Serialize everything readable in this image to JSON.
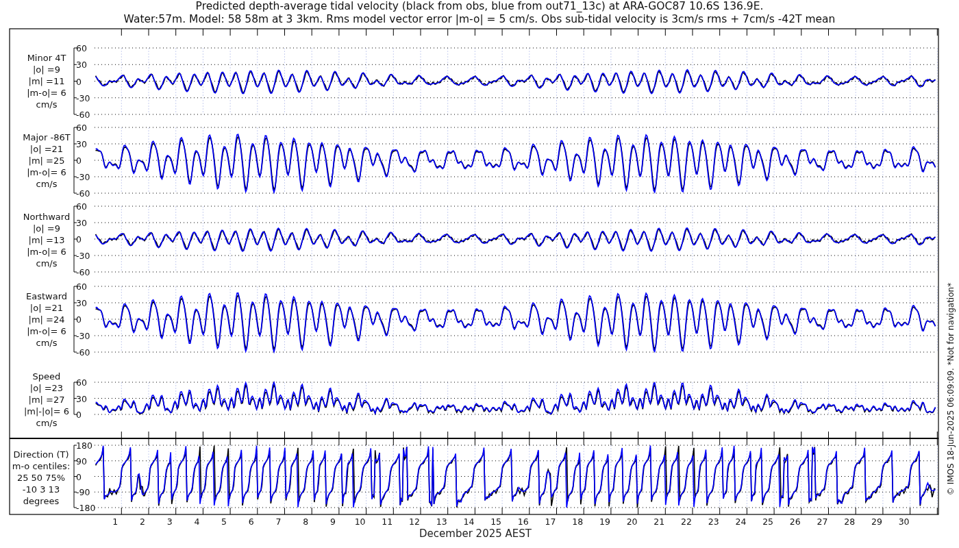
{
  "title": [
    "Predicted depth-average tidal velocity (black from obs, blue from out71_13c) at ARA-GOC87 10.6S 136.9E.",
    "Water:57m. Model: 58 58m at 3 3km. Rms model vector error |m-o| = 5 cm/s. Obs sub-tidal velocity is 3cm/s rms + 7cm/s -42T mean"
  ],
  "panels": [
    {
      "kind": "minor",
      "label_lines": [
        "Minor 4T",
        "|o| =9",
        "|m| =11",
        "|m-o|= 6",
        "cm/s"
      ],
      "yticks": [
        "60",
        "30",
        "0",
        "-30",
        "-60"
      ]
    },
    {
      "kind": "major",
      "label_lines": [
        "Major -86T",
        "|o| =21",
        "|m| =25",
        "|m-o|= 6",
        "cm/s"
      ],
      "yticks": [
        "60",
        "30",
        "0",
        "-30",
        "-60"
      ]
    },
    {
      "kind": "north",
      "label_lines": [
        "Northward",
        "|o| =9",
        "|m| =13",
        "|m-o|= 6",
        "cm/s"
      ],
      "yticks": [
        "60",
        "30",
        "0",
        "-30",
        "-60"
      ]
    },
    {
      "kind": "east",
      "label_lines": [
        "Eastward",
        "|o| =21",
        "|m| =24",
        "|m-o|= 6",
        "cm/s"
      ],
      "yticks": [
        "60",
        "30",
        "0",
        "-30",
        "-60"
      ]
    },
    {
      "kind": "speed",
      "label_lines": [
        "Speed",
        "|o| =23",
        "|m| =27",
        "|m|-|o|= 6",
        "cm/s"
      ],
      "yticks": [
        "60",
        "30",
        "0"
      ]
    },
    {
      "kind": "direction",
      "label_lines": [
        "Direction (T)",
        "m-o centiles:",
        "25  50  75%",
        "-10   3  13",
        "degrees"
      ],
      "yticks": [
        "180",
        "90",
        "0",
        "-90",
        "-180"
      ]
    }
  ],
  "x_axis": {
    "day_labels": [
      "1",
      "2",
      "3",
      "4",
      "5",
      "6",
      "7",
      "8",
      "9",
      "10",
      "11",
      "12",
      "13",
      "14",
      "15",
      "16",
      "17",
      "18",
      "19",
      "20",
      "21",
      "22",
      "23",
      "24",
      "25",
      "26",
      "27",
      "28",
      "29",
      "30"
    ],
    "label": "December 2025 AEST"
  },
  "credit": "© IMOS 18-Jun-2025 06:09:09. *Not for navigation*"
}
